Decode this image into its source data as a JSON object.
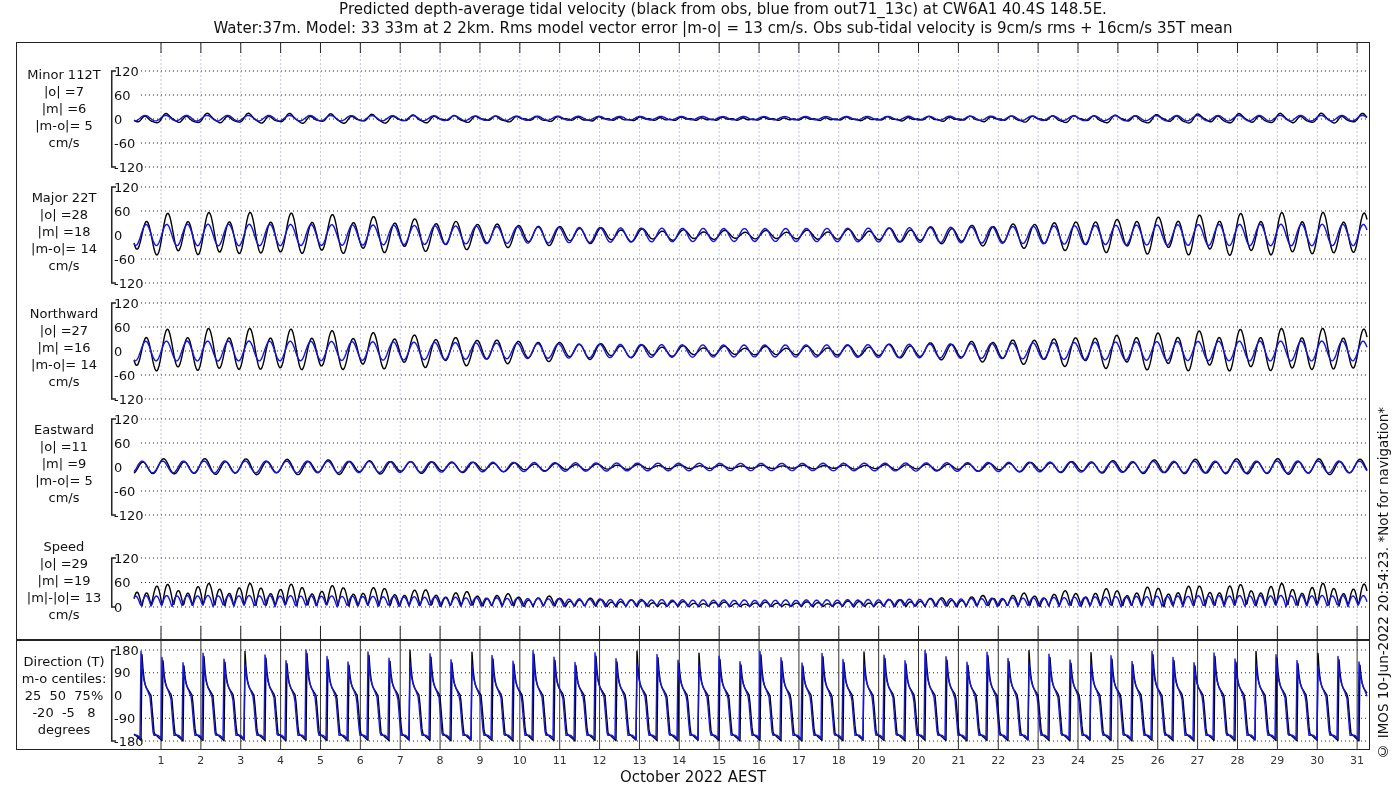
{
  "title": [
    "Predicted depth-average tidal velocity (black from obs, blue from out71_13c) at CW6A1 40.4S 148.5E.",
    "Water:37m. Model: 33 33m at 2 2km. Rms model vector error |m-o| = 13 cm/s. Obs sub-tidal velocity is 9cm/s rms + 16cm/s 35T mean"
  ],
  "panels": [
    {
      "kind": "velocity",
      "lines": [
        "Minor 112T",
        "|o| =7",
        "|m| =6",
        "|m-o|= 5",
        "cm/s"
      ],
      "yticks": [
        "120",
        "60",
        "0",
        "-60",
        "-120"
      ]
    },
    {
      "kind": "velocity",
      "lines": [
        "Major 22T",
        "|o| =28",
        "|m| =18",
        "|m-o|= 14",
        "cm/s"
      ],
      "yticks": [
        "120",
        "60",
        "0",
        "-60",
        "-120"
      ]
    },
    {
      "kind": "velocity",
      "lines": [
        "Northward",
        "|o| =27",
        "|m| =16",
        "|m-o|= 14",
        "cm/s"
      ],
      "yticks": [
        "120",
        "60",
        "0",
        "-60",
        "-120"
      ]
    },
    {
      "kind": "velocity",
      "lines": [
        "Eastward",
        "|o| =11",
        "|m| =9",
        "|m-o|= 5",
        "cm/s"
      ],
      "yticks": [
        "120",
        "60",
        "0",
        "-60",
        "-120"
      ]
    },
    {
      "kind": "speed",
      "lines": [
        "Speed",
        "|o| =29",
        "|m| =19",
        "|m|-|o|= 13",
        "cm/s"
      ],
      "yticks": [
        "120",
        "60",
        "0"
      ]
    }
  ],
  "direction_panel": {
    "kind": "direction",
    "lines": [
      "Direction (T)",
      "m-o centiles:",
      "25  50  75%",
      "-20  -5   8",
      "degrees"
    ],
    "yticks": [
      "180",
      "90",
      "0",
      "-90",
      "-180"
    ]
  },
  "xticks": [
    "1",
    "2",
    "3",
    "4",
    "5",
    "6",
    "7",
    "8",
    "9",
    "10",
    "11",
    "12",
    "13",
    "14",
    "15",
    "16",
    "17",
    "18",
    "19",
    "20",
    "21",
    "22",
    "23",
    "24",
    "25",
    "26",
    "27",
    "28",
    "29",
    "30",
    "31"
  ],
  "xlabel": "October 2022 AEST",
  "side_note": "© IMOS 10-Jun-2022 20:54:23. *Not for navigation*"
}
